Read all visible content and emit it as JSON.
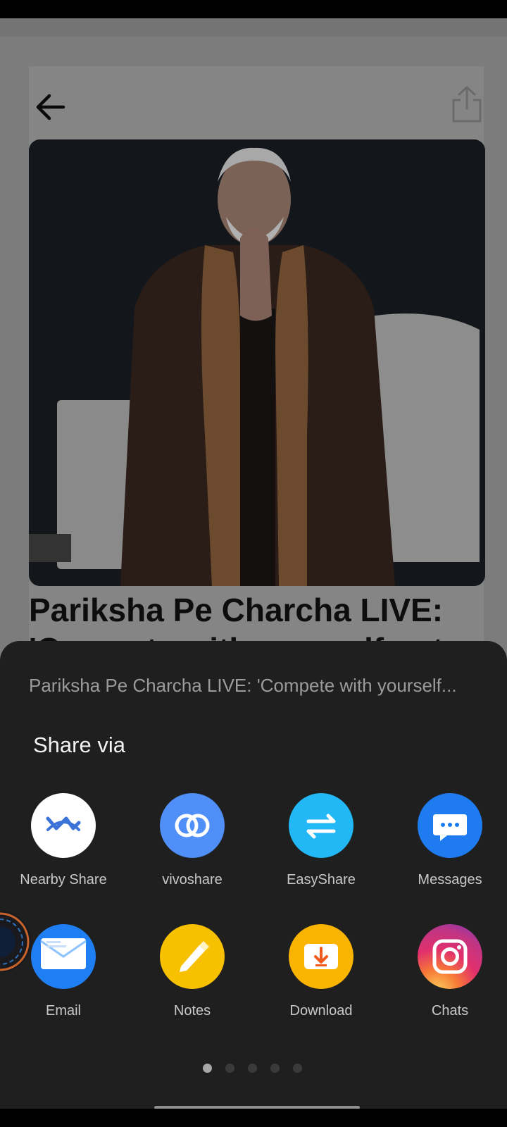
{
  "article": {
    "headline": "Pariksha Pe Charcha LIVE:",
    "headline_cont": "'Compete with yourself not"
  },
  "share_sheet": {
    "title": "Pariksha Pe Charcha LIVE: 'Compete with yourself...",
    "heading": "Share via",
    "apps": [
      {
        "label": "Nearby Share",
        "icon": "nearby-share-icon",
        "color": "#ffffff"
      },
      {
        "label": "vivoshare",
        "icon": "vivoshare-icon",
        "color": "#4f8ff7"
      },
      {
        "label": "EasyShare",
        "icon": "easyshare-icon",
        "color": "#22b8f5"
      },
      {
        "label": "Messages",
        "icon": "messages-icon",
        "color": "#1e7bf0"
      },
      {
        "label": "Email",
        "icon": "email-icon",
        "color": "#1f7ff2"
      },
      {
        "label": "Notes",
        "icon": "notes-icon",
        "color": "#f7c000"
      },
      {
        "label": "Download",
        "icon": "download-icon",
        "color": "#f8b400"
      },
      {
        "label": "Chats",
        "icon": "instagram-icon",
        "color": "#e1306c"
      }
    ],
    "page_count": 5,
    "active_page": 1
  },
  "colors": {
    "sheet_bg": "#1f1f1f",
    "dim_overlay": "#7c7c7c"
  }
}
